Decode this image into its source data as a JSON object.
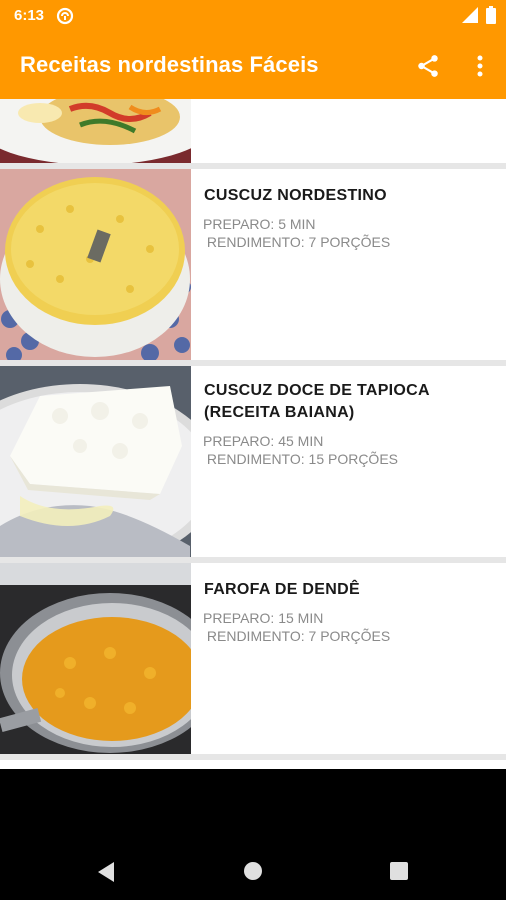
{
  "status_bar": {
    "time": "6:13",
    "notification_icon": "sync-circle-icon",
    "signal_icon": "signal-icon",
    "battery_icon": "battery-icon"
  },
  "app_bar": {
    "title": "Receitas nordestinas Fáceis",
    "share_icon": "share-icon",
    "menu_icon": "more-vert-icon",
    "color": "#ff9800"
  },
  "recipes": [
    {
      "title": "",
      "image": "mixed-vegetables-plate"
    },
    {
      "title": "CUSCUZ NORDESTINO",
      "preparo": "PREPARO: 5 MIN",
      "rendimento": " RENDIMENTO: 7 PORÇÕES",
      "image": "cuscuz-plate"
    },
    {
      "title": "CUSCUZ DOCE DE TAPIOCA",
      "title_line2": "(RECEITA BAIANA)",
      "preparo": "PREPARO: 45 MIN",
      "rendimento": " RENDIMENTO: 15 PORÇÕES",
      "image": "tapioca-cake-plate"
    },
    {
      "title": "FAROFA DE DENDÊ",
      "preparo": "PREPARO: 15 MIN",
      "rendimento": " RENDIMENTO: 7 PORÇÕES",
      "image": "farofa-pan"
    }
  ],
  "nav_bar": {
    "back_icon": "back-triangle-icon",
    "home_icon": "home-circle-icon",
    "recents_icon": "recents-square-icon"
  }
}
